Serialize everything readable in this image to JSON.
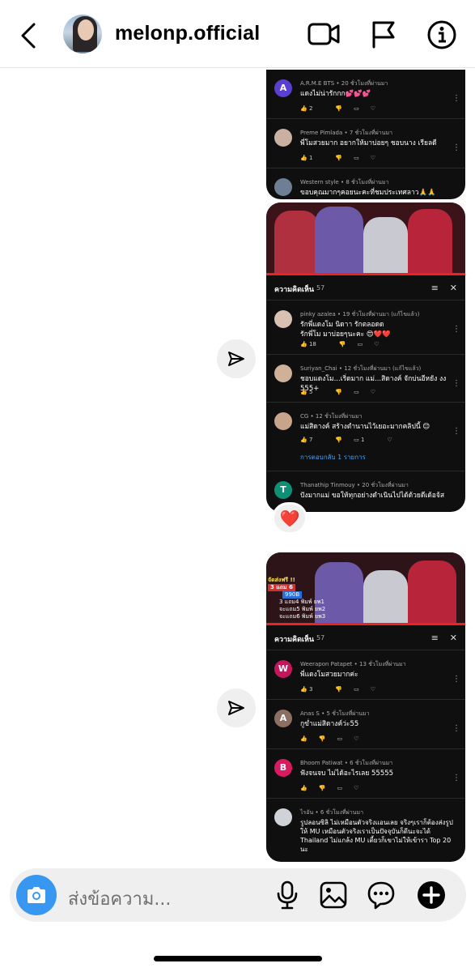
{
  "header": {
    "username": "melonp.official"
  },
  "message1": {
    "comments": [
      {
        "initial": "A",
        "avatar_color": "#5b3fd0",
        "name": "A.R.M.E BTS",
        "time": "20 ชั่วโมงที่ผ่านมา",
        "text": "แดงไม่น่ารักกก💕💕💕",
        "likes": "2"
      },
      {
        "initial": "",
        "avatar_color": "#c9b0a0",
        "name": "Preme Pimlada",
        "time": "7 ชั่วโมงที่ผ่านมา",
        "text": "พี่โมสวยมาก อยากให้มาบ่อยๆ ชอบนาง เรียลดี",
        "likes": "1"
      },
      {
        "initial": "",
        "avatar_color": "#6d7e95",
        "name": "Western style",
        "time": "8 ชั่วโมงที่ผ่านมา",
        "text": "ขอบคุณมากๆคอยนะคะที่ชมประเทศลาว🙏🙏",
        "likes": ""
      }
    ]
  },
  "message2": {
    "panel_title": "ความคิดเห็น",
    "count": "57",
    "comments": [
      {
        "initial": "",
        "avatar_color": "#d8c1b3",
        "name": "pinky azalea",
        "time": "19 ชั่วโมงที่ผ่านมา (แก้ไขแล้ว)",
        "text": "รักพี่แดงโม นิดาา รักตลอดด\nรักพี่โม มาบ่อยๆนะคะ 😍❤️❤️",
        "likes": "18"
      },
      {
        "initial": "",
        "avatar_color": "#cfb19a",
        "name": "Suriyan_Chai",
        "time": "12 ชั่วโมงที่ผ่านมา (แก้ไขแล้ว)",
        "text": "ชอบแดงโม...เริ่ดมาก แม่...สิดางค์ จักบ่นอีหยัง งง 555+",
        "likes": "5"
      },
      {
        "initial": "",
        "avatar_color": "#c8a48a",
        "name": "CG",
        "time": "12 ชั่วโมงที่ผ่านมา",
        "text": "แม่สิดางค์ สร้างตำนานไว้เยอะมากคลิปนี้ 😊",
        "likes": "7"
      },
      {
        "initial": "T",
        "avatar_color": "#0f8f74",
        "name": "Thanathip Tinmouy",
        "time": "20 ชั่วโมงที่ผ่านมา",
        "text": "ปังมากแม่ ขอให้ทุกอย่างดำเนินไปได้ด้วยดีเด้อจ้ส",
        "likes": ""
      }
    ],
    "reply_count": "1",
    "replies_link": "การตอบกลับ 1 รายการ"
  },
  "reaction": "❤️",
  "message3": {
    "panel_title": "ความคิดเห็น",
    "count": "57",
    "promo_lines": [
      "จัดส่งฟรี !!",
      "3 แถม 6",
      "990B",
      "3 แถม4 พิมพ์ ยพ1",
      "จะแถม5 พิมพ์ ยพ2",
      "จะแถม6 พิมพ์ ยพ3"
    ],
    "comments": [
      {
        "initial": "W",
        "avatar_color": "#c2185b",
        "name": "Weerapon Patapet",
        "time": "13 ชั่วโมงที่ผ่านมา",
        "text": "พี่แดงโมสวยมากค่ะ",
        "likes": "3"
      },
      {
        "initial": "A",
        "avatar_color": "#8d6e63",
        "name": "Anas S",
        "time": "5 ชั่วโมงที่ผ่านมา",
        "text": "กูข่ำแม่สิดางค์ว่ะ55",
        "likes": ""
      },
      {
        "initial": "B",
        "avatar_color": "#d81b60",
        "name": "Bhoom Patiwat",
        "time": "6 ชั่วโมงที่ผ่านมา",
        "text": "ฟังจนจบ ไม่ได้อะไรเลย 55555",
        "likes": ""
      },
      {
        "initial": "",
        "avatar_color": "#cfd3d8",
        "name": "ไรอัน",
        "time": "6 ชั่วโมงที่ผ่านมา",
        "text": "รูปลอนซิลิ ไม่เหมือนตัวจริงแอนเลย จริงๆเราก็ต้องส่งรูปให้ MU เหมือนตัวจริงเราเป็นปัจจุบันก็ดีนะจะได้ Thailand ไม่แกล้ง MU เตี้ยวก็เขาไม่ให้เข้ารา Top 20 นะ",
        "likes": ""
      }
    ]
  },
  "composer": {
    "placeholder": "ส่งข้อความ..."
  },
  "colors": {
    "accent": "#3897f0",
    "yt_dark": "#0f0f0f",
    "reply_link": "#3ea6ff"
  }
}
